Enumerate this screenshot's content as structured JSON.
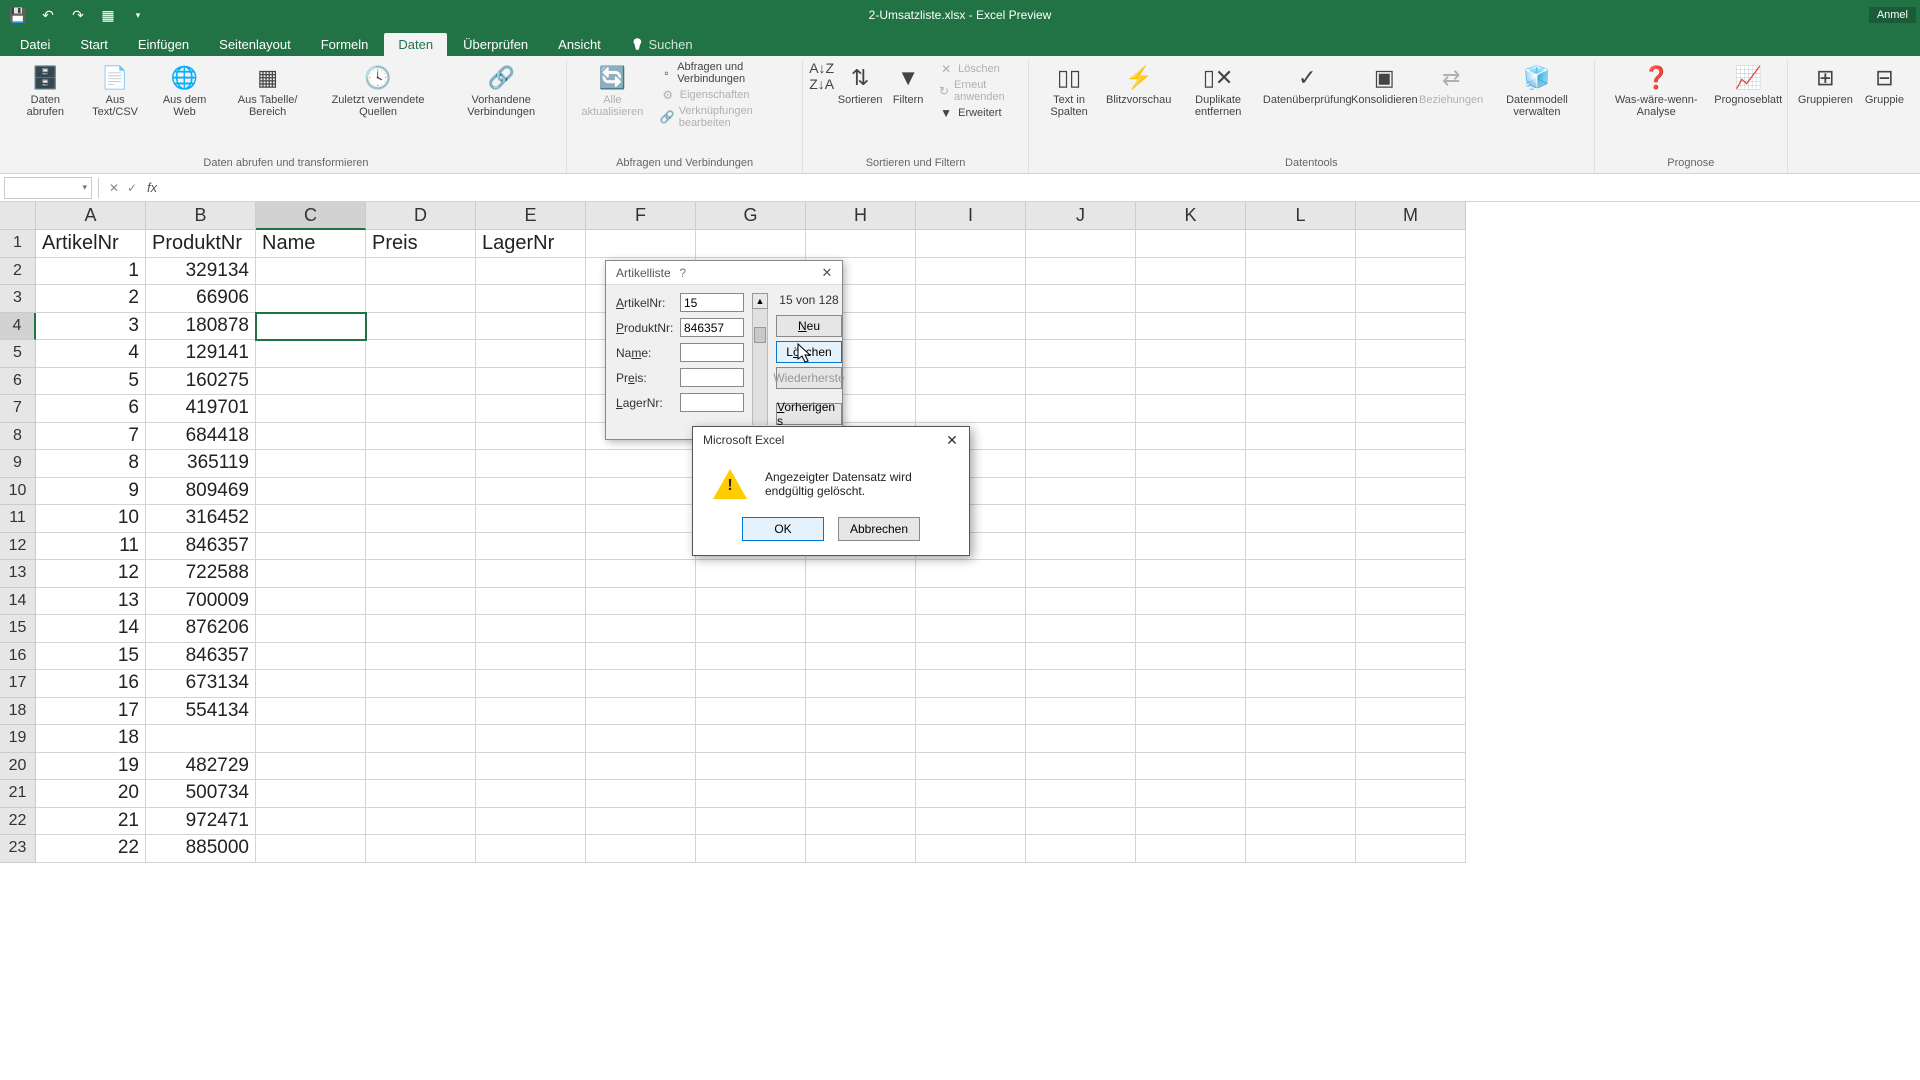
{
  "title": "2-Umsatzliste.xlsx - Excel Preview",
  "title_right": "Anmel",
  "tabs": [
    "Datei",
    "Start",
    "Einfügen",
    "Seitenlayout",
    "Formeln",
    "Daten",
    "Überprüfen",
    "Ansicht"
  ],
  "active_tab": "Daten",
  "search_hint": "Suchen",
  "ribbon_groups": {
    "g1": {
      "label": "Daten abrufen und transformieren",
      "btns": [
        "Daten abrufen",
        "Aus Text/CSV",
        "Aus dem Web",
        "Aus Tabelle/ Bereich",
        "Zuletzt verwendete Quellen",
        "Vorhandene Verbindungen"
      ]
    },
    "g2": {
      "label": "Abfragen und Verbindungen",
      "main": "Alle aktualisieren",
      "small": [
        "Abfragen und Verbindungen",
        "Eigenschaften",
        "Verknüpfungen bearbeiten"
      ]
    },
    "g3": {
      "label": "Sortieren und Filtern",
      "btns": [
        "Sortieren",
        "Filtern"
      ],
      "small": [
        "Löschen",
        "Erneut anwenden",
        "Erweitert"
      ]
    },
    "g4": {
      "label": "Datentools",
      "btns": [
        "Text in Spalten",
        "Blitzvorschau",
        "Duplikate entfernen",
        "Datenüberprüfung",
        "Konsolidieren",
        "Beziehungen",
        "Datenmodell verwalten"
      ]
    },
    "g5": {
      "label": "Prognose",
      "btns": [
        "Was-wäre-wenn-Analyse",
        "Prognoseblatt"
      ]
    },
    "g6": {
      "label": "",
      "btns": [
        "Gruppieren",
        "Gruppie"
      ]
    }
  },
  "formula": {
    "fx": "fx",
    "name_box": ""
  },
  "columns": [
    "A",
    "B",
    "C",
    "D",
    "E",
    "F",
    "G",
    "H",
    "I",
    "J",
    "K",
    "L",
    "M"
  ],
  "headers": [
    "ArtikelNr",
    "ProduktNr",
    "Name",
    "Preis",
    "LagerNr"
  ],
  "rows": [
    {
      "n": 1,
      "a": "1",
      "b": "329134"
    },
    {
      "n": 2,
      "a": "2",
      "b": "66906"
    },
    {
      "n": 3,
      "a": "3",
      "b": "180878"
    },
    {
      "n": 4,
      "a": "4",
      "b": "129141"
    },
    {
      "n": 5,
      "a": "5",
      "b": "160275"
    },
    {
      "n": 6,
      "a": "6",
      "b": "419701"
    },
    {
      "n": 7,
      "a": "7",
      "b": "684418"
    },
    {
      "n": 8,
      "a": "8",
      "b": "365119"
    },
    {
      "n": 9,
      "a": "9",
      "b": "809469"
    },
    {
      "n": 10,
      "a": "10",
      "b": "316452"
    },
    {
      "n": 11,
      "a": "11",
      "b": "846357"
    },
    {
      "n": 12,
      "a": "12",
      "b": "722588"
    },
    {
      "n": 13,
      "a": "13",
      "b": "700009"
    },
    {
      "n": 14,
      "a": "14",
      "b": "876206"
    },
    {
      "n": 15,
      "a": "15",
      "b": "846357"
    },
    {
      "n": 16,
      "a": "16",
      "b": "673134"
    },
    {
      "n": 17,
      "a": "17",
      "b": "554134"
    },
    {
      "n": 18,
      "a": "18",
      "b": ""
    },
    {
      "n": 19,
      "a": "19",
      "b": "482729"
    },
    {
      "n": 20,
      "a": "20",
      "b": "500734"
    },
    {
      "n": 21,
      "a": "21",
      "b": "972471"
    },
    {
      "n": 22,
      "a": "22",
      "b": "885000"
    }
  ],
  "dlg": {
    "title": "Artikelliste",
    "counter": "15 von 128",
    "fields": {
      "artikelnr": {
        "label": "ArtikelNr:",
        "value": "15",
        "u": "A"
      },
      "produktnr": {
        "label": "ProduktNr:",
        "value": "846357",
        "u": "P"
      },
      "name": {
        "label": "Name:",
        "value": "",
        "u": "m"
      },
      "preis": {
        "label": "Preis:",
        "value": "",
        "u": "e"
      },
      "lagernr": {
        "label": "LagerNr:",
        "value": "",
        "u": "L"
      }
    },
    "btns": {
      "neu": "Neu",
      "loeschen": "Löschen",
      "wieder": "Wiederherste",
      "vorher": "Vorherigen s"
    }
  },
  "alert": {
    "title": "Microsoft Excel",
    "msg": "Angezeigter Datensatz wird endgültig gelöscht.",
    "ok": "OK",
    "cancel": "Abbrechen"
  }
}
